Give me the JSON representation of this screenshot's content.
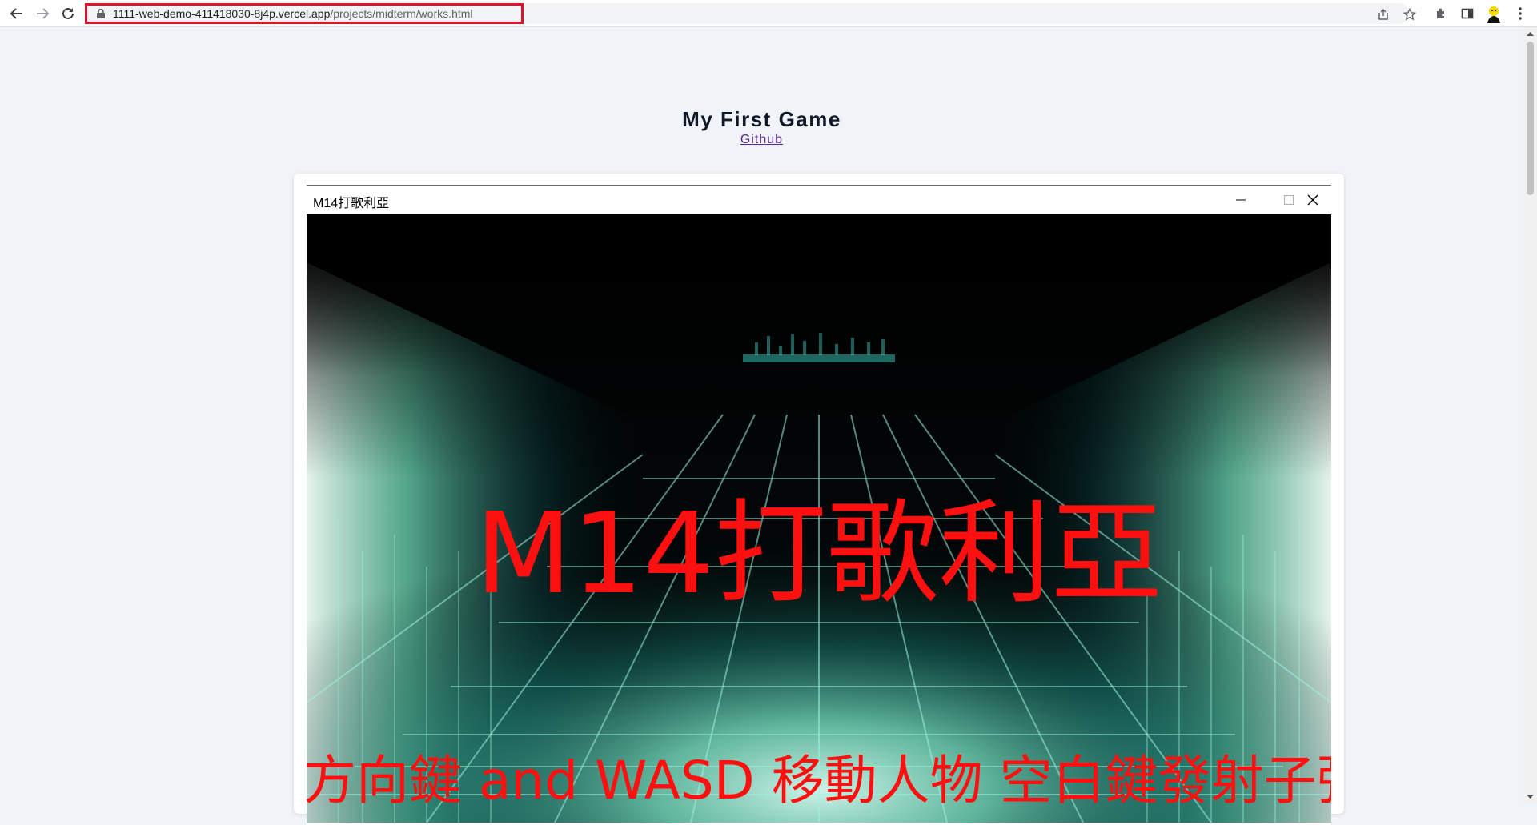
{
  "browser": {
    "url_host": "1111-web-demo-411418030-8j4p.vercel.app",
    "url_path": "/projects/midterm/works.html"
  },
  "page": {
    "title": "My First Game",
    "github_link": "Github"
  },
  "game_window": {
    "title": "M14打歌利亞",
    "game_title": "M14打歌利亞",
    "instructions": "方向鍵 and WASD 移動人物 空白鍵發射子彈"
  },
  "colors": {
    "url_highlight": "#e0112b",
    "game_text": "#ff1010",
    "page_bg": "#f0f3f7"
  }
}
